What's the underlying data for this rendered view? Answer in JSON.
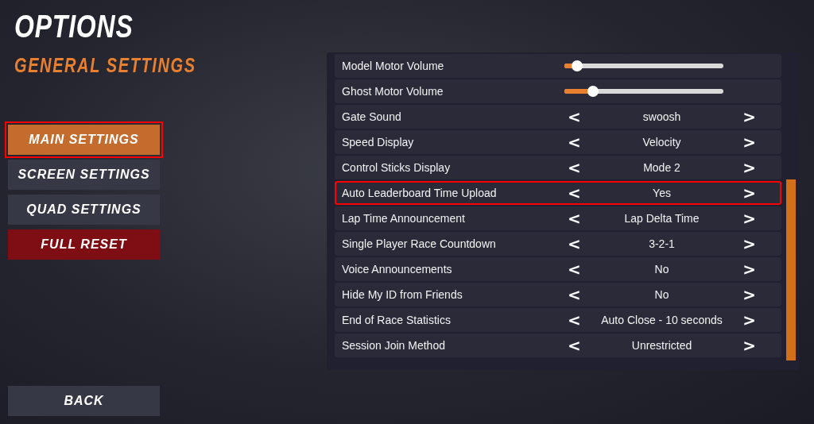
{
  "title": "OPTIONS",
  "subtitle": "GENERAL SETTINGS",
  "menu": [
    {
      "label": "MAIN SETTINGS",
      "kind": "normal",
      "selected": true
    },
    {
      "label": "SCREEN SETTINGS",
      "kind": "normal",
      "selected": false
    },
    {
      "label": "QUAD SETTINGS",
      "kind": "normal",
      "selected": false
    },
    {
      "label": "FULL RESET",
      "kind": "danger",
      "selected": false
    }
  ],
  "back_button": "BACK",
  "settings": [
    {
      "label": "Model Motor Volume",
      "kind": "slider",
      "level": 0.08,
      "selected": false
    },
    {
      "label": "Ghost Motor Volume",
      "kind": "slider",
      "level": 0.18,
      "selected": false
    },
    {
      "label": "Gate Sound",
      "kind": "choice",
      "value": "swoosh",
      "prev": "<",
      "next": ">",
      "selected": false
    },
    {
      "label": "Speed Display",
      "kind": "choice",
      "value": "Velocity",
      "prev": "<",
      "next": ">",
      "selected": false
    },
    {
      "label": "Control Sticks Display",
      "kind": "choice",
      "value": "Mode 2",
      "prev": "<",
      "next": ">",
      "selected": false
    },
    {
      "label": "Auto Leaderboard Time Upload",
      "kind": "choice",
      "value": "Yes",
      "prev": "<",
      "next": ">",
      "selected": true
    },
    {
      "label": "Lap Time Announcement",
      "kind": "choice",
      "value": "Lap Delta Time",
      "prev": "<",
      "next": ">",
      "selected": false
    },
    {
      "label": "Single Player Race Countdown",
      "kind": "choice",
      "value": "3-2-1",
      "prev": "<",
      "next": ">",
      "selected": false
    },
    {
      "label": "Voice Announcements",
      "kind": "choice",
      "value": "No",
      "prev": "<",
      "next": ">",
      "selected": false
    },
    {
      "label": "Hide My ID from Friends",
      "kind": "choice",
      "value": "No",
      "prev": "<",
      "next": ">",
      "selected": false
    },
    {
      "label": "End of Race Statistics",
      "kind": "choice",
      "value": "Auto Close - 10 seconds",
      "prev": "<",
      "next": ">",
      "selected": false
    },
    {
      "label": "Session Join Method",
      "kind": "choice",
      "value": "Unrestricted",
      "prev": "<",
      "next": ">",
      "selected": false
    }
  ]
}
